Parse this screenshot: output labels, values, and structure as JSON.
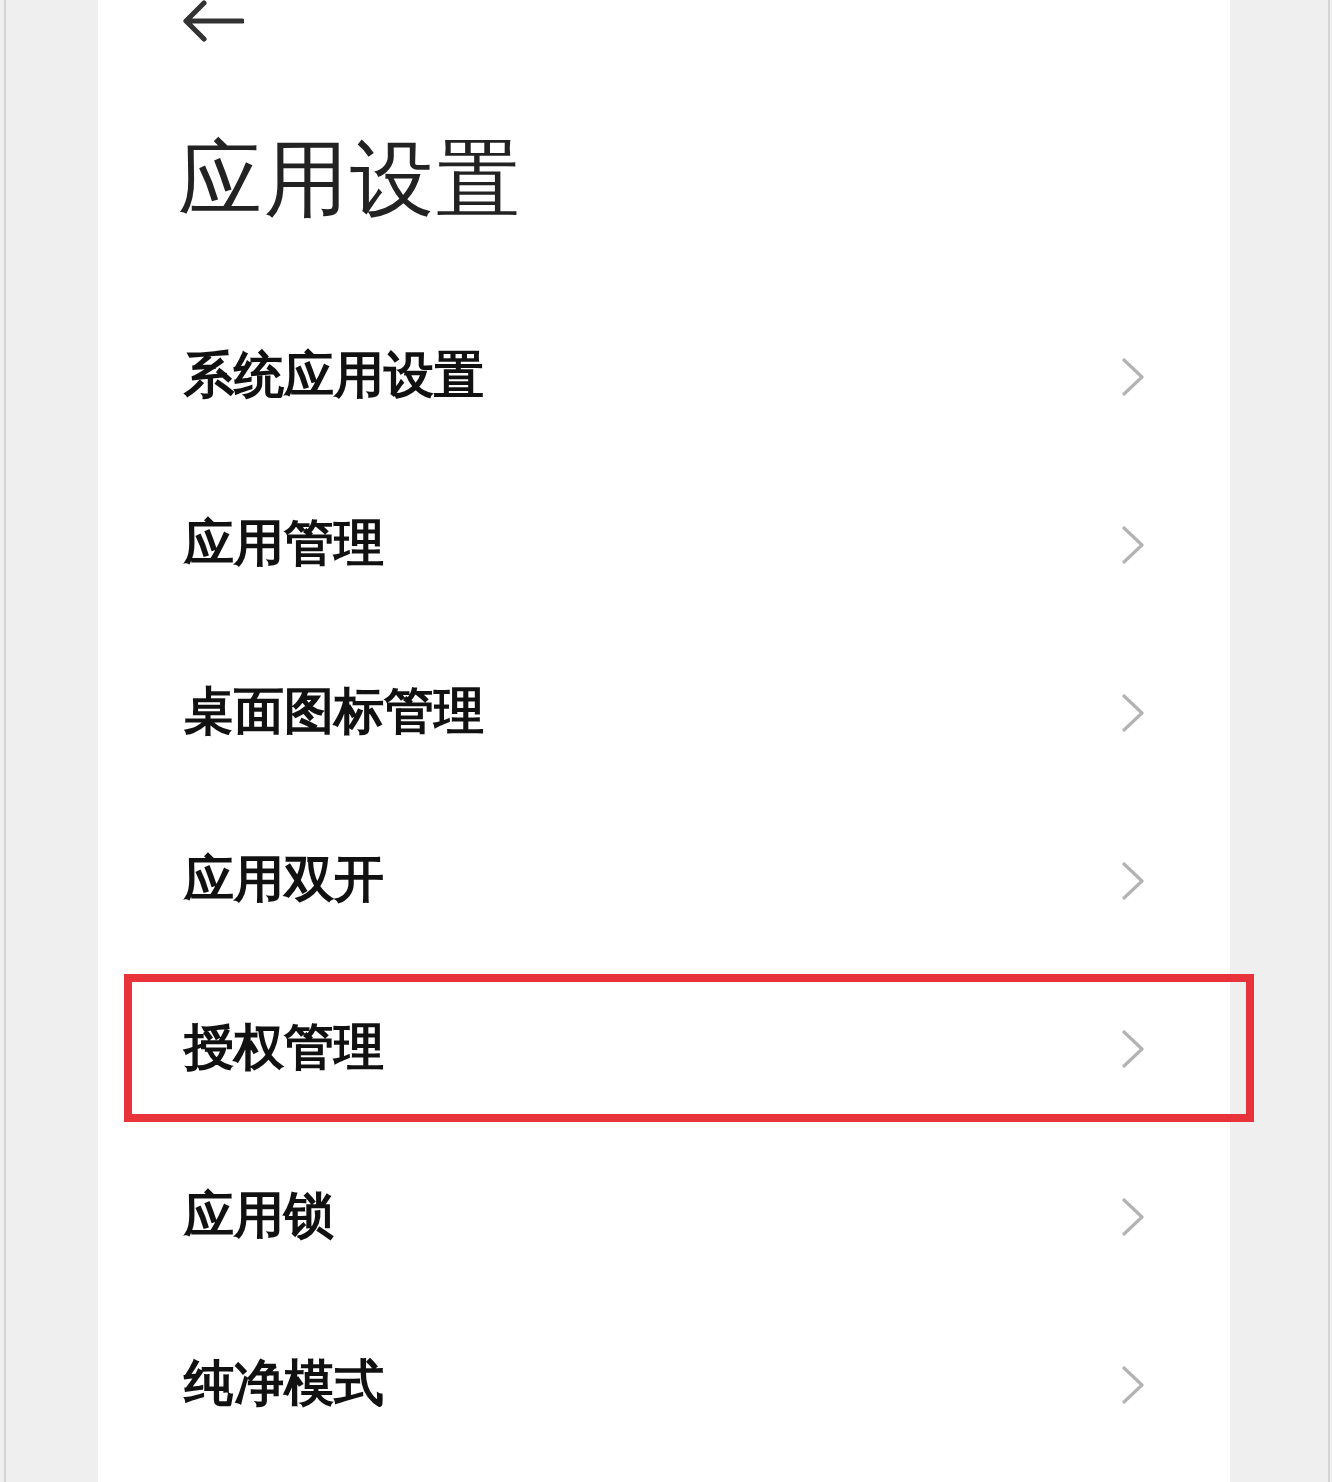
{
  "header": {
    "title": "应用设置"
  },
  "items": [
    {
      "label": "系统应用设置",
      "highlighted": false
    },
    {
      "label": "应用管理",
      "highlighted": false
    },
    {
      "label": "桌面图标管理",
      "highlighted": false
    },
    {
      "label": "应用双开",
      "highlighted": false
    },
    {
      "label": "授权管理",
      "highlighted": true
    },
    {
      "label": "应用锁",
      "highlighted": false
    },
    {
      "label": "纯净模式",
      "highlighted": false
    }
  ]
}
